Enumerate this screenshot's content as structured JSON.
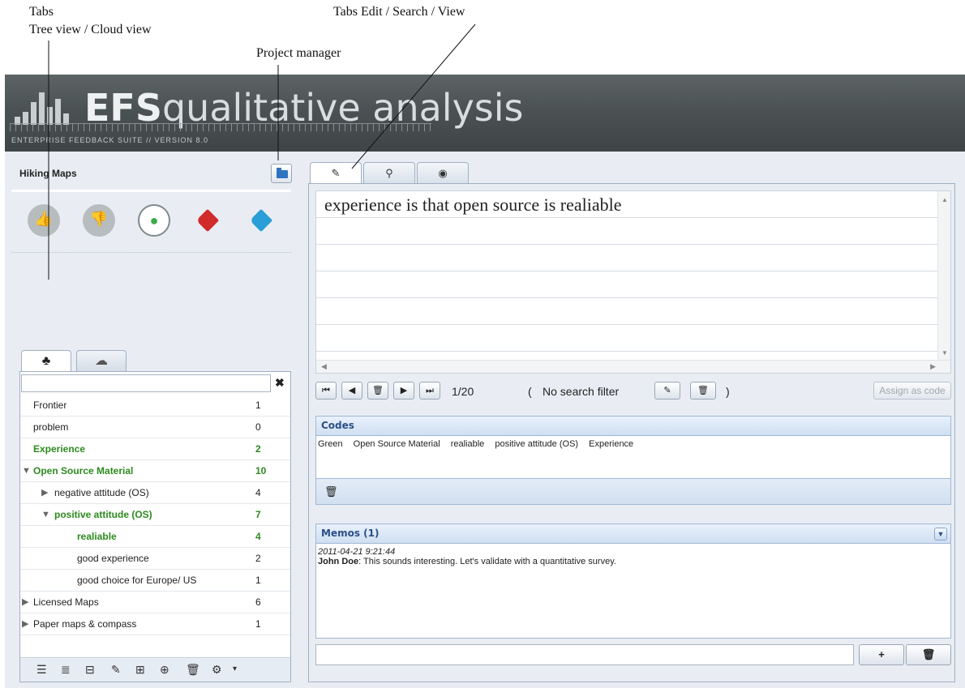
{
  "annotations": {
    "tabs": "Tabs",
    "tree_cloud": "Tree view / Cloud view",
    "project_manager": "Project manager",
    "tabs_edit": "Tabs Edit / Search / View"
  },
  "banner": {
    "brand": "EFS",
    "title": "qualitative analysis",
    "subtitle": "ENTERPRISE FEEDBACK SUITE // VERSION 8.0"
  },
  "project": {
    "name": "Hiking Maps",
    "manager_icon": "folder-icon"
  },
  "code_icons": [
    "thumbs-up-icon",
    "thumbs-down-icon",
    "green-tag-icon",
    "red-tag-icon",
    "blue-tag-icon"
  ],
  "left_tabs": [
    {
      "icon": "tree-icon",
      "glyph": "♣"
    },
    {
      "icon": "cloud-icon",
      "glyph": "☁"
    }
  ],
  "tree": {
    "search_value": "",
    "clear_glyph": "✖",
    "rows": [
      {
        "label": "Frontier",
        "count": "1",
        "level": 0,
        "arrow": "",
        "green": false
      },
      {
        "label": "problem",
        "count": "0",
        "level": 0,
        "arrow": "",
        "green": false
      },
      {
        "label": "Experience",
        "count": "2",
        "level": 0,
        "arrow": "",
        "green": true
      },
      {
        "label": "Open Source Material",
        "count": "10",
        "level": 0,
        "arrow": "▼",
        "green": true
      },
      {
        "label": "negative attitude (OS)",
        "count": "4",
        "level": 1,
        "arrow": "▶",
        "green": false
      },
      {
        "label": "positive attitude (OS)",
        "count": "7",
        "level": 1,
        "arrow": "▼",
        "green": true
      },
      {
        "label": "realiable",
        "count": "4",
        "level": 2,
        "arrow": "",
        "green": true
      },
      {
        "label": "good experience",
        "count": "2",
        "level": 2,
        "arrow": "",
        "green": false
      },
      {
        "label": "good choice for Europe/ US",
        "count": "1",
        "level": 2,
        "arrow": "",
        "green": false
      },
      {
        "label": "Licensed Maps",
        "count": "6",
        "level": 0,
        "arrow": "▶",
        "green": false
      },
      {
        "label": "Paper maps & compass",
        "count": "1",
        "level": 0,
        "arrow": "▶",
        "green": false
      }
    ],
    "toolbar_icons": [
      "align-left-icon",
      "indent-icon",
      "outdent-icon",
      "edit-pencil-icon",
      "add-node-icon",
      "add-child-icon",
      "delete-icon",
      "settings-gear-icon"
    ]
  },
  "right_tabs": [
    {
      "name": "edit",
      "glyph": "✎"
    },
    {
      "name": "search",
      "glyph": "⚲"
    },
    {
      "name": "view",
      "glyph": "◉"
    }
  ],
  "text_view": {
    "text": "experience is that open source is realiable"
  },
  "navigation": {
    "counter": "1/20",
    "filter_open": "(",
    "filter_text": "No search filter",
    "filter_close": ")",
    "assign_label": "Assign as code"
  },
  "codes": {
    "title": "Codes",
    "items": [
      "Green",
      "Open Source Material",
      "realiable",
      "positive attitude (OS)",
      "Experience"
    ]
  },
  "memos": {
    "title": "Memos (1)",
    "date": "2011-04-21 9:21:44",
    "author": "John Doe",
    "text": ": This sounds interesting. Let's validate with a quantitative survey.",
    "input_value": "",
    "add_label": "+"
  }
}
